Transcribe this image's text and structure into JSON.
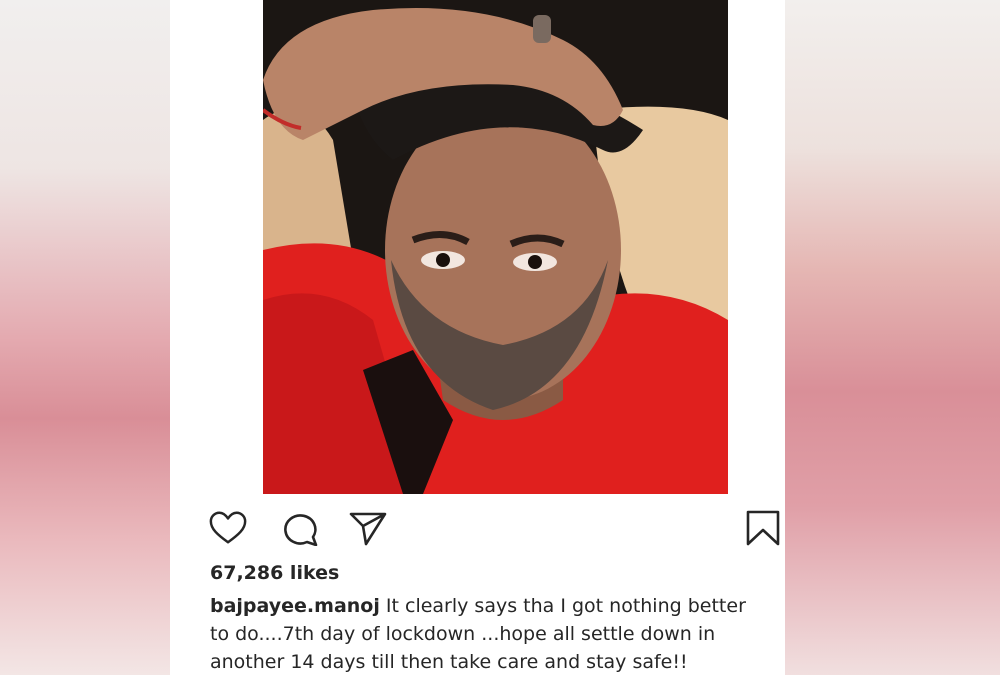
{
  "post": {
    "photo_alt": "",
    "actions": {
      "like_icon": "heart-outline",
      "comment_icon": "speech-bubble-outline",
      "share_icon": "paper-plane-outline",
      "save_icon": "bookmark-outline"
    },
    "likes_text": "67,286 likes",
    "username": "bajpayee.manoj",
    "caption_line1": "It clearly says tha I got nothing better",
    "caption_line2": "to do....7th day of lockdown ...hope all settle down in",
    "caption_line3": "another 14 days till then take care and stay safe!!"
  },
  "colors": {
    "shirt_red": "#e0201e",
    "text": "#262626",
    "background": "#ffffff"
  }
}
